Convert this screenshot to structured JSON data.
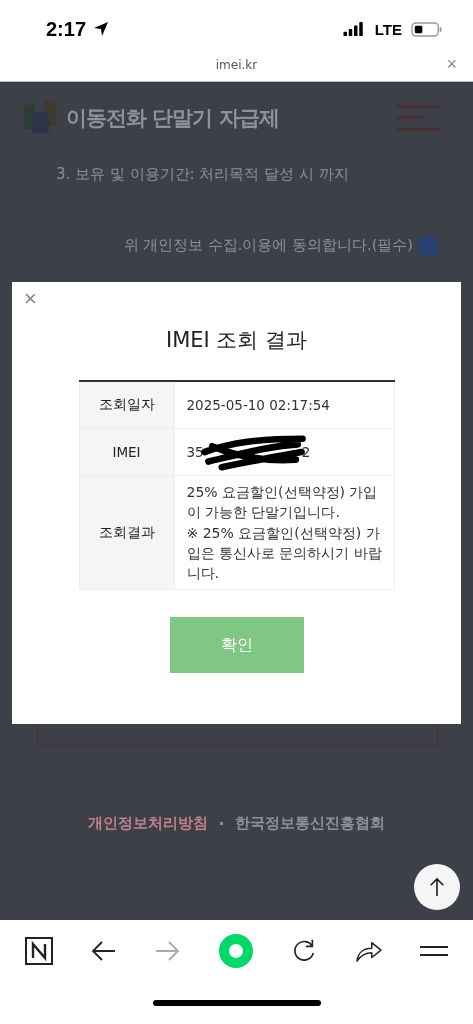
{
  "status_bar": {
    "time": "2:17",
    "network": "LTE"
  },
  "browser": {
    "url": "imei.kr",
    "close": "×"
  },
  "page": {
    "logo_text": "이동전화 단말기 자급제",
    "retention": "3. 보유 및 이용기간: 처리목적 달성 시 까지",
    "consent": {
      "label": "위 개인정보 수집.이용에 동의합니다.(필수)",
      "checked": true
    },
    "footer_links": [
      {
        "label": "개인정보처리방침",
        "kind": "policy"
      },
      {
        "label": "한국정보통신진흥협회",
        "kind": "org"
      }
    ],
    "footer_separator": "·"
  },
  "modal": {
    "close": "×",
    "title": "IMEI 조회 결과",
    "rows": [
      {
        "label": "조회일자",
        "kind": "text",
        "value": "2025-05-10 02:17:54"
      },
      {
        "label": "IMEI",
        "kind": "redacted",
        "prefix": "35",
        "suffix": "2"
      },
      {
        "label": "조회결과",
        "kind": "lines",
        "lines": [
          "25% 요금할인(선택약정) 가입이 가능한 단말기입니다.",
          "※ 25% 요금할인(선택약정) 가입은 통신사로 문의하시기 바랍니다."
        ]
      }
    ],
    "confirm": "확인"
  }
}
